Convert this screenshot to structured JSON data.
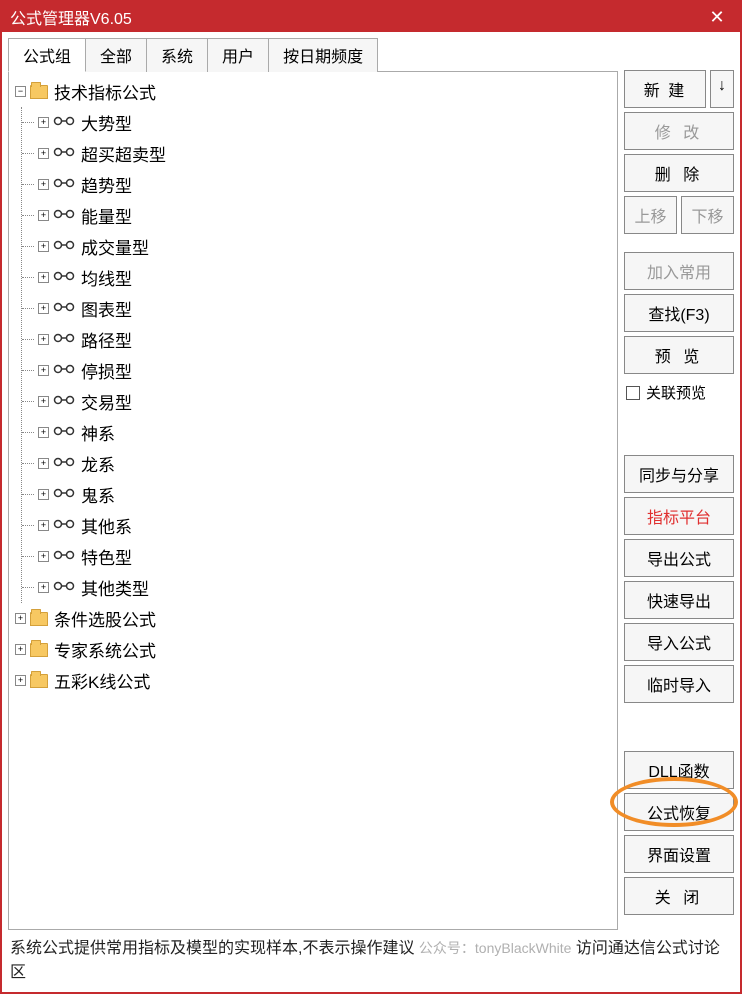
{
  "window": {
    "title": "公式管理器V6.05"
  },
  "tabs": [
    "公式组",
    "全部",
    "系统",
    "用户",
    "按日期频度"
  ],
  "tree": {
    "root": [
      {
        "label": "技术指标公式",
        "expanded": true,
        "children": [
          {
            "label": "大势型"
          },
          {
            "label": "超买超卖型"
          },
          {
            "label": "趋势型"
          },
          {
            "label": "能量型"
          },
          {
            "label": "成交量型"
          },
          {
            "label": "均线型"
          },
          {
            "label": "图表型"
          },
          {
            "label": "路径型"
          },
          {
            "label": "停损型"
          },
          {
            "label": "交易型"
          },
          {
            "label": "神系"
          },
          {
            "label": "龙系"
          },
          {
            "label": "鬼系"
          },
          {
            "label": "其他系"
          },
          {
            "label": "特色型"
          },
          {
            "label": "其他类型"
          }
        ]
      },
      {
        "label": "条件选股公式",
        "expanded": false
      },
      {
        "label": "专家系统公式",
        "expanded": false
      },
      {
        "label": "五彩K线公式",
        "expanded": false
      }
    ]
  },
  "buttons": {
    "new": "新 建",
    "new_arrow": "↓",
    "modify": "修 改",
    "delete": "删 除",
    "move_up": "上移",
    "move_down": "下移",
    "add_common": "加入常用",
    "find": "查找(F3)",
    "preview": "预 览",
    "link_preview_label": "关联预览",
    "sync_share": "同步与分享",
    "indicator_platform": "指标平台",
    "export_formula": "导出公式",
    "quick_export": "快速导出",
    "import_formula": "导入公式",
    "temp_import": "临时导入",
    "dll_func": "DLL函数",
    "formula_restore": "公式恢复",
    "ui_settings": "界面设置",
    "close": "关 闭"
  },
  "footer": {
    "text": "系统公式提供常用指标及模型的实现样本,不表示操作建议",
    "text2": "访问通达信公式讨论区",
    "watermark": "公众号：tonyBlackWhite"
  }
}
